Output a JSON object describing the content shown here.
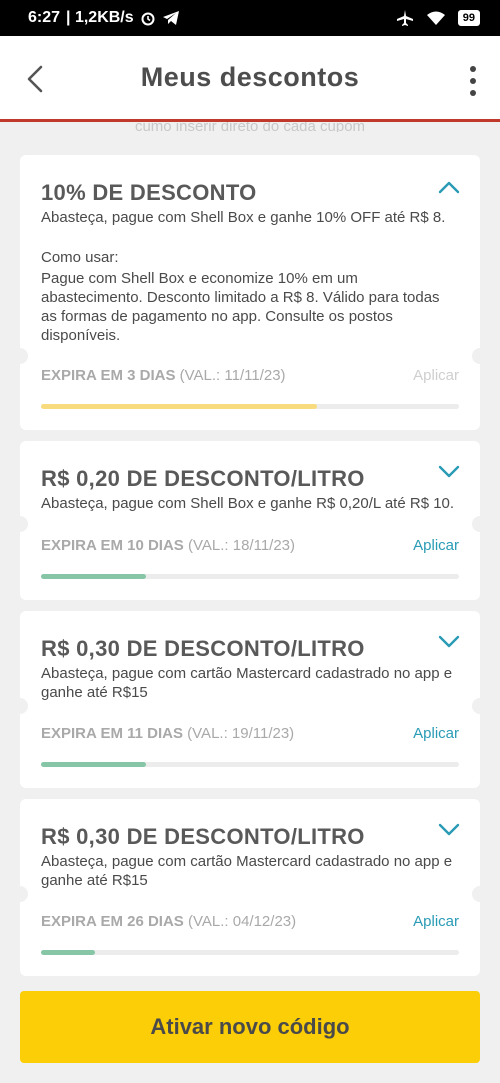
{
  "status_bar": {
    "time": "6:27",
    "network": "| 1,2KB/s",
    "battery": "99"
  },
  "header": {
    "title": "Meus descontos"
  },
  "faded_text": "cumo inserir direto do cada cupom",
  "coupons": [
    {
      "title": "10% DE DESCONTO",
      "description": "Abasteça, pague com Shell Box e ganhe 10% OFF até R$ 8.",
      "howto_label": "Como usar:",
      "howto": "Pague com Shell Box e economize 10%  em um abastecimento. Desconto limitado a R$ 8. Válido para todas as formas de pagamento no app. Consulte os postos disponíveis.",
      "expira": "EXPIRA EM 3 DIAS",
      "validade": "(VAL.: 11/11/23)",
      "apply_label": "Aplicar",
      "apply_enabled": false,
      "progress": 0.66,
      "progress_color": "#f8db7c",
      "expanded": true
    },
    {
      "title": "R$ 0,20 DE DESCONTO/LITRO",
      "description": "Abasteça, pague com Shell Box e ganhe R$ 0,20/L até R$ 10.",
      "expira": "EXPIRA EM 10 DIAS",
      "validade": "(VAL.: 18/11/23)",
      "apply_label": "Aplicar",
      "apply_enabled": true,
      "progress": 0.25,
      "progress_color": "#86c6a6",
      "expanded": false
    },
    {
      "title": "R$ 0,30 DE DESCONTO/LITRO",
      "description": "Abasteça, pague com cartão Mastercard cadastrado no app e ganhe até R$15",
      "expira": "EXPIRA EM 11 DIAS",
      "validade": "(VAL.: 19/11/23)",
      "apply_label": "Aplicar",
      "apply_enabled": true,
      "progress": 0.25,
      "progress_color": "#86c6a6",
      "expanded": false
    },
    {
      "title": "R$ 0,30 DE DESCONTO/LITRO",
      "description": "Abasteça, pague com cartão Mastercard cadastrado no app e ganhe até R$15",
      "expira": "EXPIRA EM 26 DIAS",
      "validade": "(VAL.: 04/12/23)",
      "apply_label": "Aplicar",
      "apply_enabled": true,
      "progress": 0.13,
      "progress_color": "#86c6a6",
      "expanded": false
    }
  ],
  "cta": {
    "label": "Ativar novo código"
  },
  "colors": {
    "accent": "#2a9bb5",
    "brand_yellow": "#fbce07",
    "header_border": "#c0392b"
  },
  "icons": {
    "back": "chevron-left-icon",
    "menu": "more-vertical-icon",
    "collapse": "chevron-up-icon",
    "expand": "chevron-down-icon"
  }
}
